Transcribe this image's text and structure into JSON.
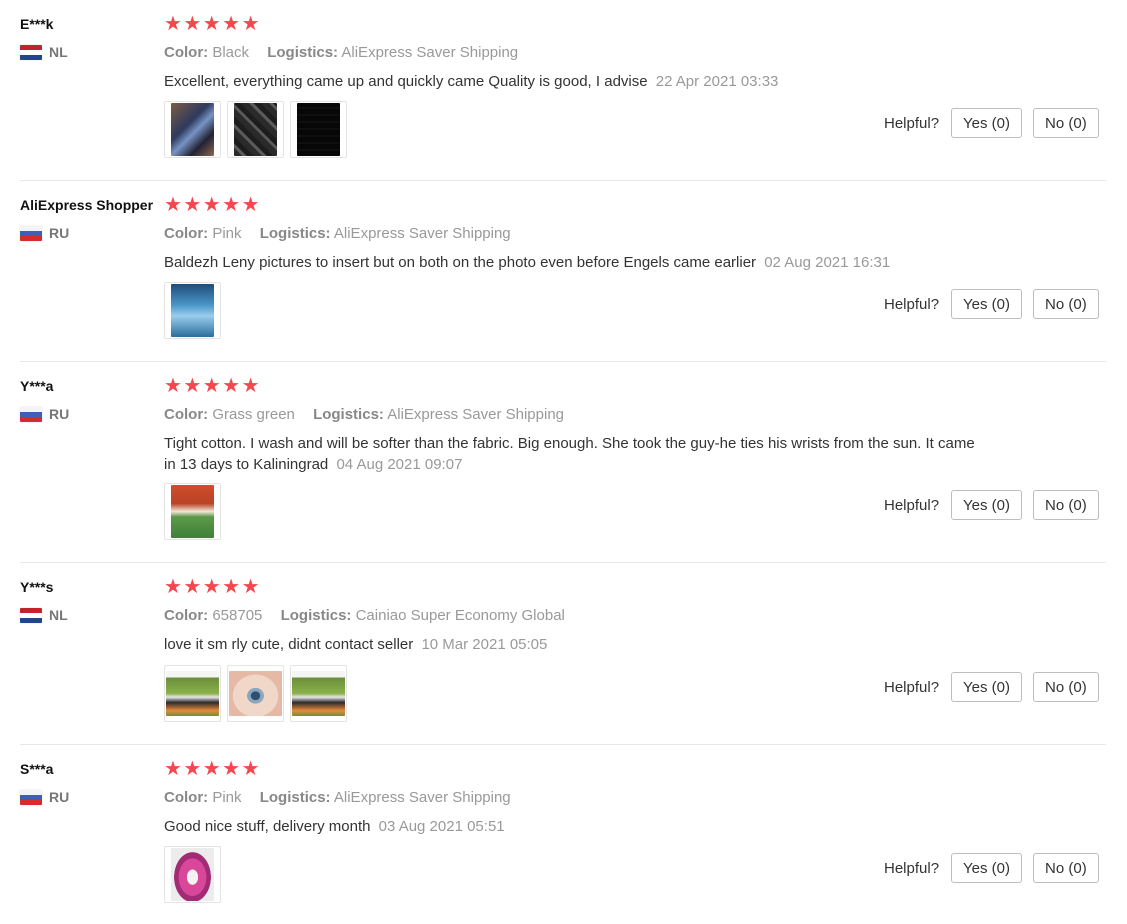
{
  "helpful_label": "Helpful?",
  "star_color": "#f5474d",
  "reviews": [
    {
      "user": "E***k",
      "country": "NL",
      "rating": 5,
      "color_key": "Color:",
      "color_value": "Black",
      "logistics_key": "Logistics:",
      "logistics_value": "AliExpress Saver Shipping",
      "text": "Excellent, everything came up and quickly came Quality is good, I advise",
      "date": "22 Apr 2021 03:33",
      "photos": [
        "review-photo",
        "review-photo",
        "review-photo"
      ],
      "yes_label": "Yes (0)",
      "no_label": "No (0)"
    },
    {
      "user": "AliExpress Shopper",
      "country": "RU",
      "rating": 5,
      "color_key": "Color:",
      "color_value": "Pink",
      "logistics_key": "Logistics:",
      "logistics_value": "AliExpress Saver Shipping",
      "text": "Baldezh Leny pictures to insert but on both on the photo even before Engels came earlier",
      "date": "02 Aug 2021 16:31",
      "photos": [
        "review-photo"
      ],
      "yes_label": "Yes (0)",
      "no_label": "No (0)"
    },
    {
      "user": "Y***a",
      "country": "RU",
      "rating": 5,
      "color_key": "Color:",
      "color_value": "Grass green",
      "logistics_key": "Logistics:",
      "logistics_value": "AliExpress Saver Shipping",
      "text": "Tight cotton. I wash and will be softer than the fabric. Big enough. She took the guy-he ties his wrists from the sun. It came in 13 days to Kaliningrad",
      "date": "04 Aug 2021 09:07",
      "photos": [
        "review-photo"
      ],
      "yes_label": "Yes (0)",
      "no_label": "No (0)"
    },
    {
      "user": "Y***s",
      "country": "NL",
      "rating": 5,
      "color_key": "Color:",
      "color_value": "658705",
      "logistics_key": "Logistics:",
      "logistics_value": "Cainiao Super Economy Global",
      "text": "love it sm rly cute, didnt contact seller",
      "date": "10 Mar 2021 05:05",
      "photos": [
        "review-photo",
        "review-photo",
        "review-photo"
      ],
      "yes_label": "Yes (0)",
      "no_label": "No (0)"
    },
    {
      "user": "S***a",
      "country": "RU",
      "rating": 5,
      "color_key": "Color:",
      "color_value": "Pink",
      "logistics_key": "Logistics:",
      "logistics_value": "AliExpress Saver Shipping",
      "text": "Good nice stuff, delivery month",
      "date": "03 Aug 2021 05:51",
      "photos": [
        "review-photo"
      ],
      "yes_label": "Yes (0)",
      "no_label": "No (0)"
    }
  ]
}
